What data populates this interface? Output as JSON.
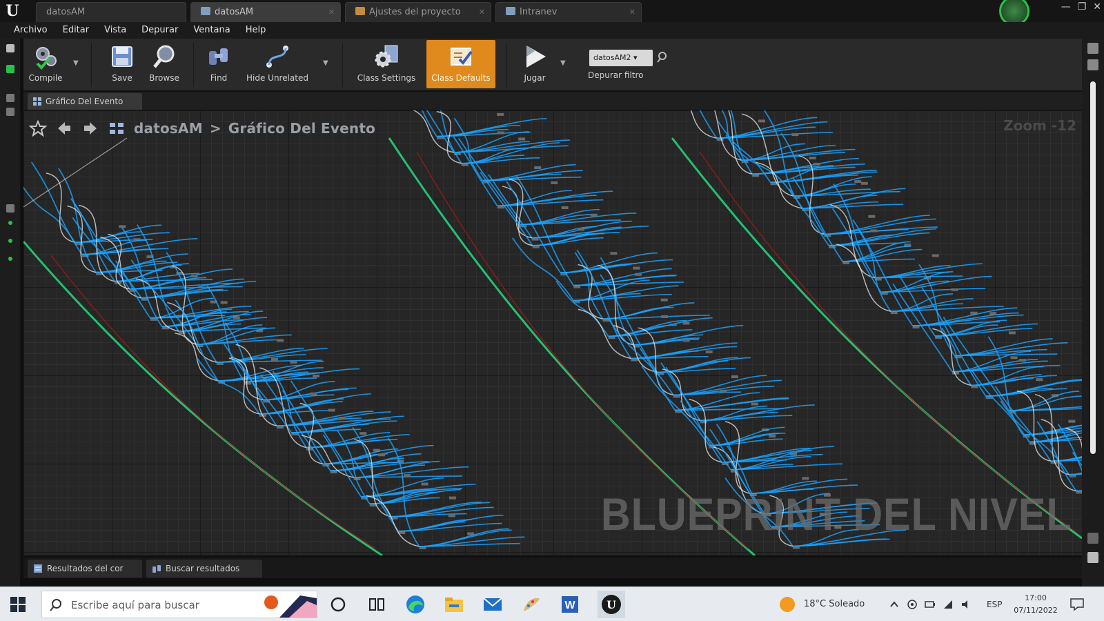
{
  "window": {
    "tabs": [
      {
        "label": "datosAM"
      },
      {
        "label": "datosAM"
      },
      {
        "label": "Ajustes del proyecto"
      },
      {
        "label": "Intranev"
      }
    ],
    "controls": [
      "—",
      "❐",
      "✕"
    ]
  },
  "menu": [
    "Archivo",
    "Editar",
    "Vista",
    "Depurar",
    "Ventana",
    "Help"
  ],
  "toolbar": {
    "compile": "Compile",
    "save": "Save",
    "browse": "Browse",
    "find": "Find",
    "hide_unrelated": "Hide Unrelated",
    "class_settings": "Class Settings",
    "class_defaults": "Class Defaults",
    "play": "Jugar",
    "debug_select": "datosAM2 ▾",
    "debug_filter_label": "Depurar filtro",
    "accent_color": "#e08a1e"
  },
  "graph_tab": {
    "label": "Gráfico Del Evento"
  },
  "breadcrumb": {
    "root": "datosAM",
    "separator": ">",
    "current": "Gráfico Del Evento"
  },
  "zoom": "Zoom -12",
  "watermark": "BLUEPRINT DEL NIVEL",
  "bottom_tabs": [
    "Resultados del cor",
    "Buscar resultados"
  ],
  "taskbar": {
    "search_placeholder": "Escribe aquí para buscar",
    "weather": "18°C  Soleado",
    "language": "ESP",
    "time": "17:00",
    "date": "07/11/2022"
  },
  "wire_colors": {
    "exec": "#e8e8e8",
    "blue": "#1aa3ff",
    "green": "#27d07a",
    "red": "#b01818"
  }
}
